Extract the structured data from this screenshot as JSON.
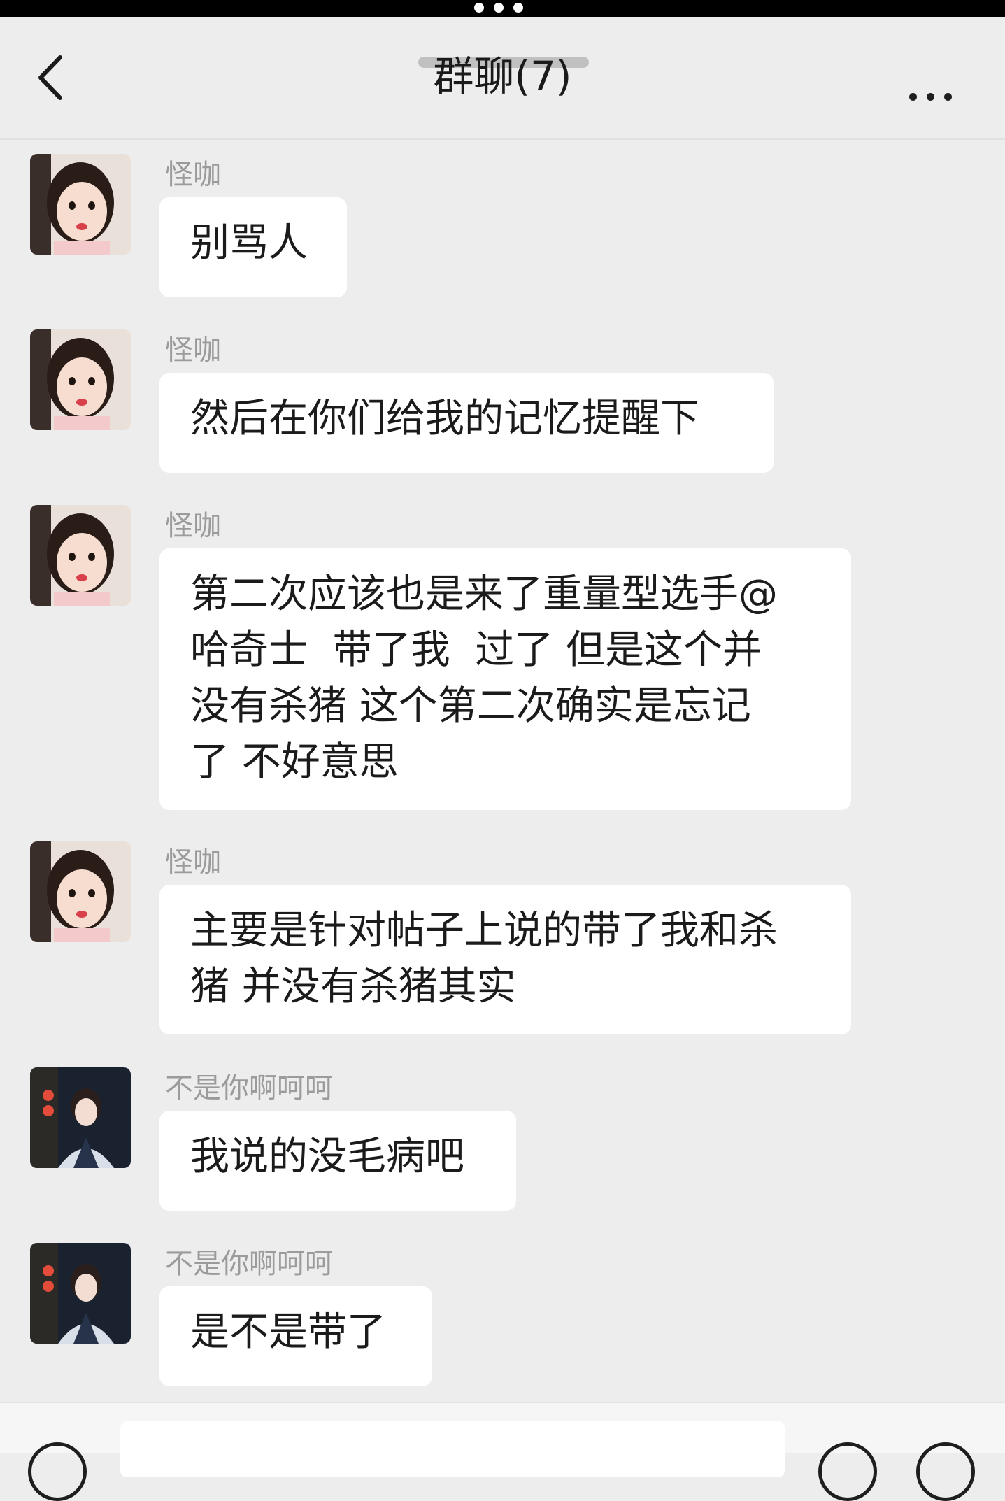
{
  "header": {
    "title": "群聊(7)"
  },
  "messages": [
    {
      "sender": "怪咖",
      "text": "别骂人",
      "avatar": "girl-avatar"
    },
    {
      "sender": "怪咖",
      "text": "然后在你们给我的记忆提醒下",
      "avatar": "girl-avatar"
    },
    {
      "sender": "怪咖",
      "text": "第二次应该也是来了重量型选手@\n哈奇士  带了我  过了 但是这个并\n没有杀猪 这个第二次确实是忘记\n了 不好意思",
      "avatar": "girl-avatar"
    },
    {
      "sender": "怪咖",
      "text": "主要是针对帖子上说的带了我和杀\n猪 并没有杀猪其实",
      "avatar": "girl-avatar"
    },
    {
      "sender": "不是你啊呵呵",
      "text": "我说的没毛病吧",
      "avatar": "boy-avatar"
    },
    {
      "sender": "不是你啊呵呵",
      "text": "是不是带了",
      "avatar": "boy-avatar"
    }
  ],
  "icons": {
    "back": "chevron-left-icon",
    "more": "more-dots-icon",
    "voice": "voice-icon",
    "emoji": "emoji-icon",
    "plus": "plus-icon"
  }
}
